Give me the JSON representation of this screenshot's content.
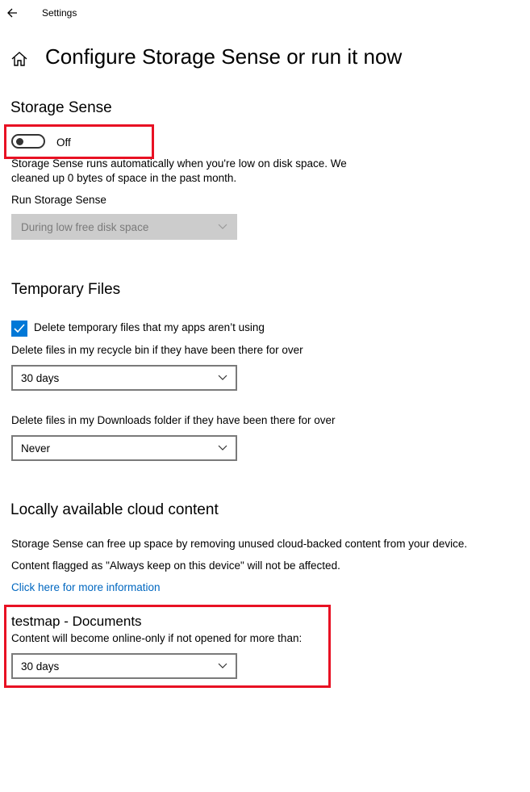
{
  "window": {
    "title": "Settings",
    "back_icon": "back-arrow-icon"
  },
  "page": {
    "home_icon": "home-icon",
    "title": "Configure Storage Sense or run it now"
  },
  "storage_sense": {
    "heading": "Storage Sense",
    "toggle_state": "Off",
    "description_line1": "Storage Sense runs automatically when you're low on disk space. We",
    "description_line2": "cleaned up 0 bytes of space in the past month.",
    "run_label": "Run Storage Sense",
    "run_value": "During low free disk space"
  },
  "temporary_files": {
    "heading": "Temporary Files",
    "checkbox_label": "Delete temporary files that my apps aren’t using",
    "checkbox_checked": true,
    "recycle_label": "Delete files in my recycle bin if they have been there for over",
    "recycle_value": "30 days",
    "downloads_label": "Delete files in my Downloads folder if they have been there for over",
    "downloads_value": "Never"
  },
  "cloud_content": {
    "heading": "Locally available cloud content",
    "line1": "Storage Sense can free up space by removing unused cloud-backed content from your device.",
    "line2": "Content flagged as \"Always keep on this device\" will not be affected.",
    "link": "Click here for more information",
    "folder_title": "testmap - Documents",
    "folder_label": "Content will become online-only if not opened for more than:",
    "folder_value": "30 days"
  },
  "colors": {
    "accent": "#0078d7",
    "link": "#0067c0",
    "highlight": "#e81123"
  }
}
